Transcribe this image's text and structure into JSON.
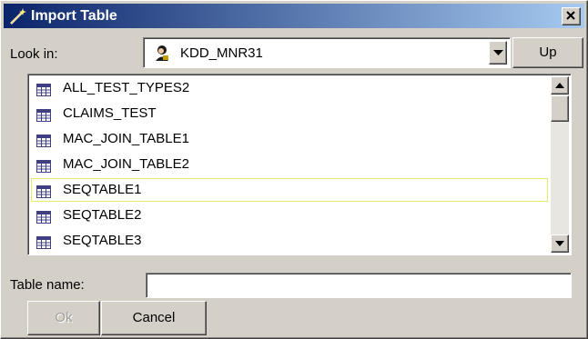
{
  "window": {
    "title": "Import Table"
  },
  "look_in": {
    "label": "Look in:",
    "value": "KDD_MNR31",
    "up_label": "Up"
  },
  "tables": [
    "ALL_TEST_TYPES2",
    "CLAIMS_TEST",
    "MAC_JOIN_TABLE1",
    "MAC_JOIN_TABLE2",
    "SEQTABLE1",
    "SEQTABLE2",
    "SEQTABLE3"
  ],
  "selected_table": "SEQTABLE1",
  "table_name": {
    "label": "Table name:",
    "value": ""
  },
  "buttons": {
    "ok": "Ok",
    "cancel": "Cancel"
  },
  "icons": {
    "title": "wand-icon",
    "schema": "user-schema-icon",
    "table": "table-icon"
  },
  "colors": {
    "title_start": "#0a246a",
    "title_end": "#a6caf0",
    "selection_border": "#e8e86a"
  }
}
